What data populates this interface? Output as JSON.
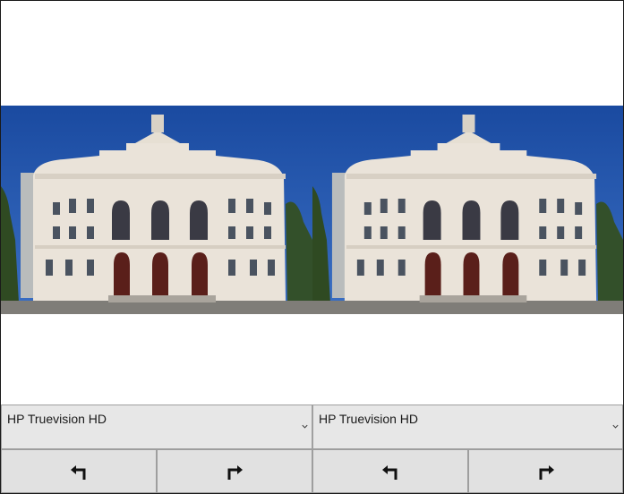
{
  "cameras": [
    {
      "device_label": "HP Truevision HD",
      "rotate_left_icon": "rotate-left-arrow-icon",
      "rotate_right_icon": "rotate-right-arrow-icon"
    },
    {
      "device_label": "HP Truevision HD",
      "rotate_left_icon": "rotate-left-arrow-icon",
      "rotate_right_icon": "rotate-right-arrow-icon"
    }
  ],
  "colors": {
    "sky": "#1f4fa6",
    "facade": "#ece6dc",
    "control_bg": "#e1e1e1"
  }
}
